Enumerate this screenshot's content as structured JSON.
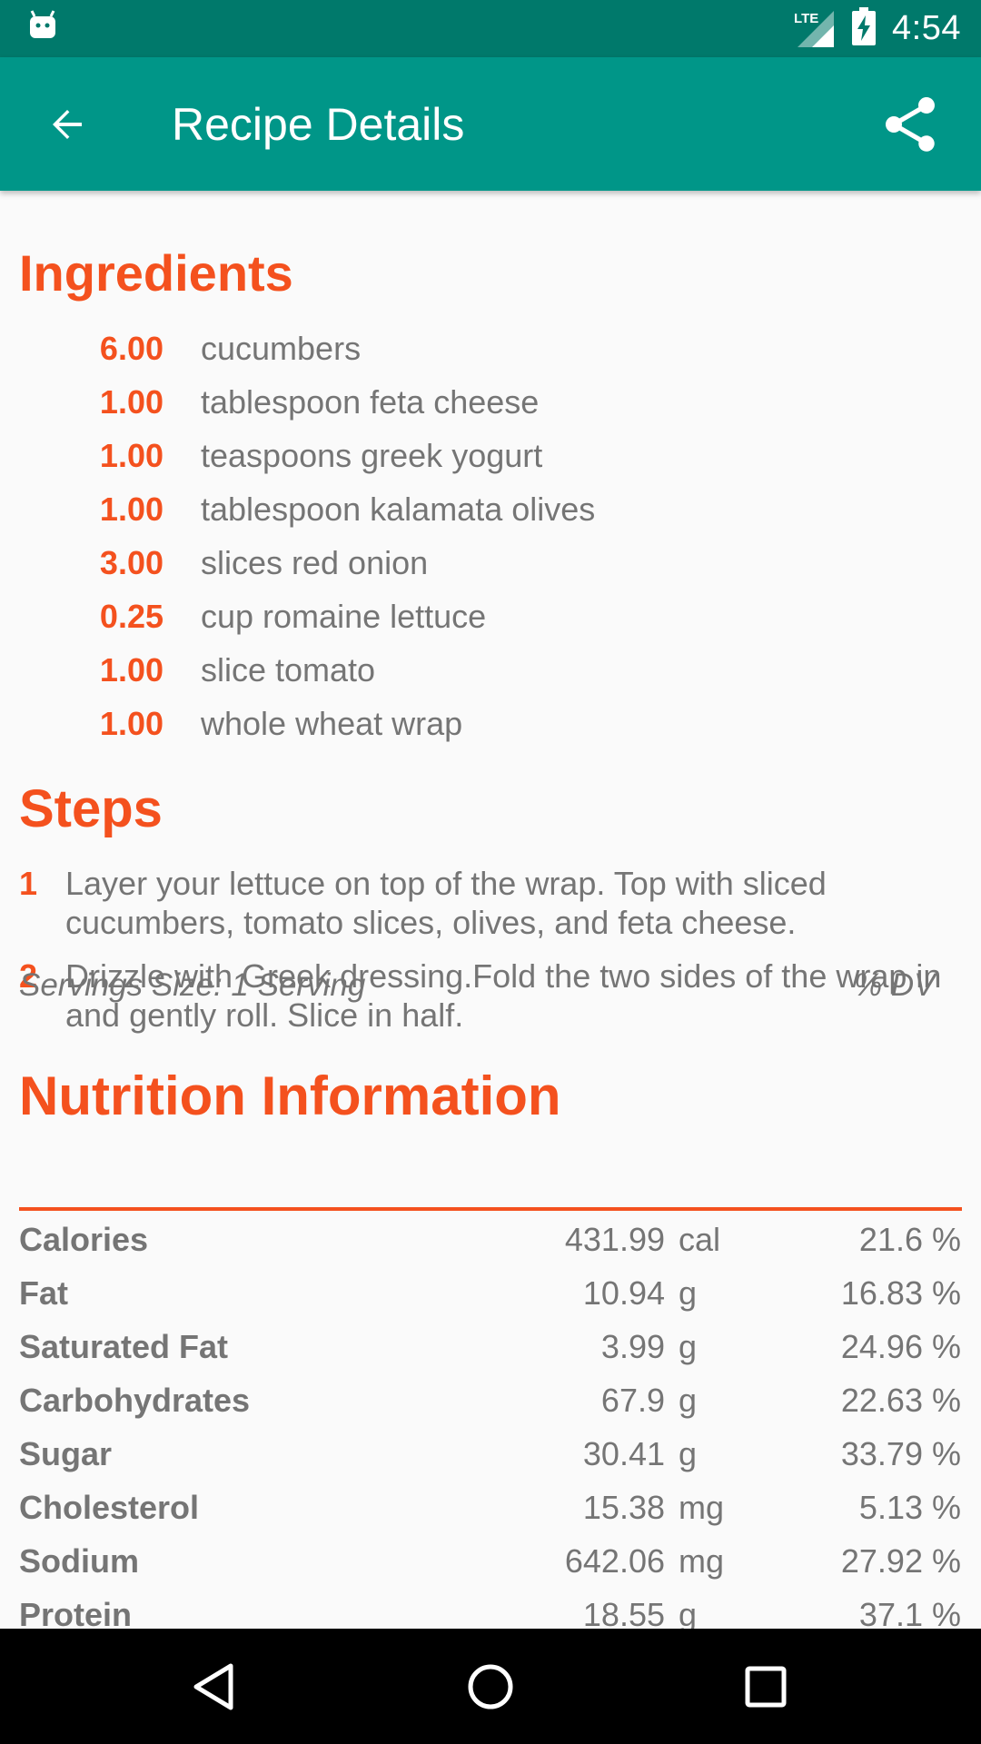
{
  "status_bar": {
    "time": "4:54",
    "network_label": "LTE"
  },
  "app_bar": {
    "title": "Recipe Details"
  },
  "ingredients": {
    "title": "Ingredients",
    "items": [
      {
        "qty": "6.00",
        "name": "cucumbers"
      },
      {
        "qty": "1.00",
        "name": "tablespoon feta cheese"
      },
      {
        "qty": "1.00",
        "name": "teaspoons greek yogurt"
      },
      {
        "qty": "1.00",
        "name": "tablespoon kalamata olives"
      },
      {
        "qty": "3.00",
        "name": "slices red onion"
      },
      {
        "qty": "0.25",
        "name": "cup romaine lettuce"
      },
      {
        "qty": "1.00",
        "name": "slice tomato"
      },
      {
        "qty": "1.00",
        "name": "whole wheat wrap"
      }
    ]
  },
  "steps": {
    "title": "Steps",
    "items": [
      {
        "num": "1",
        "text": "Layer your lettuce on top of the wrap. Top with sliced cucumbers, tomato slices, olives, and feta cheese."
      },
      {
        "num": "2",
        "text": "Drizzle with Greek dressing.Fold the two sides of the wrap in and gently roll. Slice in half."
      }
    ]
  },
  "nutrition": {
    "title": "Nutrition Information",
    "serving_size": "Servings Size: 1 Serving",
    "dv_header": "% DV",
    "rows": [
      {
        "label": "Calories",
        "value": "431.99",
        "unit": "cal",
        "dv": "21.6 %"
      },
      {
        "label": "Fat",
        "value": "10.94",
        "unit": "g",
        "dv": "16.83 %"
      },
      {
        "label": "Saturated Fat",
        "value": "3.99",
        "unit": "g",
        "dv": "24.96 %"
      },
      {
        "label": "Carbohydrates",
        "value": "67.9",
        "unit": "g",
        "dv": "22.63 %"
      },
      {
        "label": "Sugar",
        "value": "30.41",
        "unit": "g",
        "dv": "33.79 %"
      },
      {
        "label": "Cholesterol",
        "value": "15.38",
        "unit": "mg",
        "dv": "5.13 %"
      },
      {
        "label": "Sodium",
        "value": "642.06",
        "unit": "mg",
        "dv": "27.92 %"
      },
      {
        "label": "Protein",
        "value": "18.55",
        "unit": "g",
        "dv": "37.1 %"
      }
    ]
  }
}
